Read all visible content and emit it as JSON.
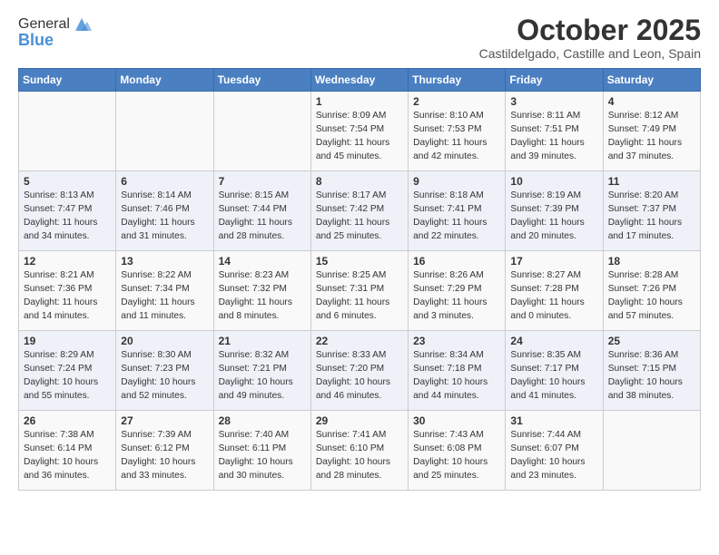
{
  "header": {
    "logo_general": "General",
    "logo_blue": "Blue",
    "month": "October 2025",
    "location": "Castildelgado, Castille and Leon, Spain"
  },
  "weekdays": [
    "Sunday",
    "Monday",
    "Tuesday",
    "Wednesday",
    "Thursday",
    "Friday",
    "Saturday"
  ],
  "weeks": [
    [
      {
        "day": "",
        "info": ""
      },
      {
        "day": "",
        "info": ""
      },
      {
        "day": "",
        "info": ""
      },
      {
        "day": "1",
        "info": "Sunrise: 8:09 AM\nSunset: 7:54 PM\nDaylight: 11 hours\nand 45 minutes."
      },
      {
        "day": "2",
        "info": "Sunrise: 8:10 AM\nSunset: 7:53 PM\nDaylight: 11 hours\nand 42 minutes."
      },
      {
        "day": "3",
        "info": "Sunrise: 8:11 AM\nSunset: 7:51 PM\nDaylight: 11 hours\nand 39 minutes."
      },
      {
        "day": "4",
        "info": "Sunrise: 8:12 AM\nSunset: 7:49 PM\nDaylight: 11 hours\nand 37 minutes."
      }
    ],
    [
      {
        "day": "5",
        "info": "Sunrise: 8:13 AM\nSunset: 7:47 PM\nDaylight: 11 hours\nand 34 minutes."
      },
      {
        "day": "6",
        "info": "Sunrise: 8:14 AM\nSunset: 7:46 PM\nDaylight: 11 hours\nand 31 minutes."
      },
      {
        "day": "7",
        "info": "Sunrise: 8:15 AM\nSunset: 7:44 PM\nDaylight: 11 hours\nand 28 minutes."
      },
      {
        "day": "8",
        "info": "Sunrise: 8:17 AM\nSunset: 7:42 PM\nDaylight: 11 hours\nand 25 minutes."
      },
      {
        "day": "9",
        "info": "Sunrise: 8:18 AM\nSunset: 7:41 PM\nDaylight: 11 hours\nand 22 minutes."
      },
      {
        "day": "10",
        "info": "Sunrise: 8:19 AM\nSunset: 7:39 PM\nDaylight: 11 hours\nand 20 minutes."
      },
      {
        "day": "11",
        "info": "Sunrise: 8:20 AM\nSunset: 7:37 PM\nDaylight: 11 hours\nand 17 minutes."
      }
    ],
    [
      {
        "day": "12",
        "info": "Sunrise: 8:21 AM\nSunset: 7:36 PM\nDaylight: 11 hours\nand 14 minutes."
      },
      {
        "day": "13",
        "info": "Sunrise: 8:22 AM\nSunset: 7:34 PM\nDaylight: 11 hours\nand 11 minutes."
      },
      {
        "day": "14",
        "info": "Sunrise: 8:23 AM\nSunset: 7:32 PM\nDaylight: 11 hours\nand 8 minutes."
      },
      {
        "day": "15",
        "info": "Sunrise: 8:25 AM\nSunset: 7:31 PM\nDaylight: 11 hours\nand 6 minutes."
      },
      {
        "day": "16",
        "info": "Sunrise: 8:26 AM\nSunset: 7:29 PM\nDaylight: 11 hours\nand 3 minutes."
      },
      {
        "day": "17",
        "info": "Sunrise: 8:27 AM\nSunset: 7:28 PM\nDaylight: 11 hours\nand 0 minutes."
      },
      {
        "day": "18",
        "info": "Sunrise: 8:28 AM\nSunset: 7:26 PM\nDaylight: 10 hours\nand 57 minutes."
      }
    ],
    [
      {
        "day": "19",
        "info": "Sunrise: 8:29 AM\nSunset: 7:24 PM\nDaylight: 10 hours\nand 55 minutes."
      },
      {
        "day": "20",
        "info": "Sunrise: 8:30 AM\nSunset: 7:23 PM\nDaylight: 10 hours\nand 52 minutes."
      },
      {
        "day": "21",
        "info": "Sunrise: 8:32 AM\nSunset: 7:21 PM\nDaylight: 10 hours\nand 49 minutes."
      },
      {
        "day": "22",
        "info": "Sunrise: 8:33 AM\nSunset: 7:20 PM\nDaylight: 10 hours\nand 46 minutes."
      },
      {
        "day": "23",
        "info": "Sunrise: 8:34 AM\nSunset: 7:18 PM\nDaylight: 10 hours\nand 44 minutes."
      },
      {
        "day": "24",
        "info": "Sunrise: 8:35 AM\nSunset: 7:17 PM\nDaylight: 10 hours\nand 41 minutes."
      },
      {
        "day": "25",
        "info": "Sunrise: 8:36 AM\nSunset: 7:15 PM\nDaylight: 10 hours\nand 38 minutes."
      }
    ],
    [
      {
        "day": "26",
        "info": "Sunrise: 7:38 AM\nSunset: 6:14 PM\nDaylight: 10 hours\nand 36 minutes."
      },
      {
        "day": "27",
        "info": "Sunrise: 7:39 AM\nSunset: 6:12 PM\nDaylight: 10 hours\nand 33 minutes."
      },
      {
        "day": "28",
        "info": "Sunrise: 7:40 AM\nSunset: 6:11 PM\nDaylight: 10 hours\nand 30 minutes."
      },
      {
        "day": "29",
        "info": "Sunrise: 7:41 AM\nSunset: 6:10 PM\nDaylight: 10 hours\nand 28 minutes."
      },
      {
        "day": "30",
        "info": "Sunrise: 7:43 AM\nSunset: 6:08 PM\nDaylight: 10 hours\nand 25 minutes."
      },
      {
        "day": "31",
        "info": "Sunrise: 7:44 AM\nSunset: 6:07 PM\nDaylight: 10 hours\nand 23 minutes."
      },
      {
        "day": "",
        "info": ""
      }
    ]
  ]
}
